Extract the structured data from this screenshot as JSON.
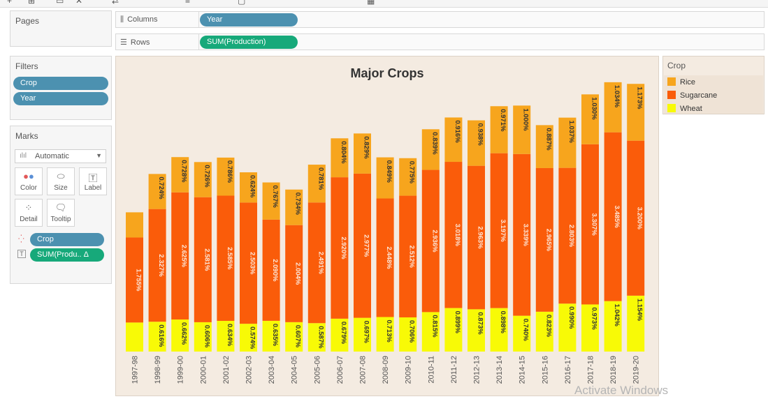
{
  "shelves": {
    "columns": {
      "label": "Columns",
      "pill": "Year"
    },
    "rows": {
      "label": "Rows",
      "pill": "SUM(Production)"
    }
  },
  "pages": {
    "title": "Pages"
  },
  "filters": {
    "title": "Filters",
    "pills": [
      "Crop",
      "Year"
    ]
  },
  "marks": {
    "title": "Marks",
    "type_select": "Automatic",
    "buttons": [
      "Color",
      "Size",
      "Label",
      "Detail",
      "Tooltip"
    ],
    "field_pills": [
      "Crop",
      "SUM(Produ.. Δ"
    ]
  },
  "legend": {
    "title": "Crop",
    "items": [
      {
        "name": "Rice",
        "color": "#f7a51d"
      },
      {
        "name": "Sugarcane",
        "color": "#fa5c0a"
      },
      {
        "name": "Wheat",
        "color": "#f8fa06"
      }
    ]
  },
  "watermark": "Activate Windows",
  "chart_data": {
    "type": "bar",
    "stacked": true,
    "title": "Major Crops",
    "categories": [
      "1997-98",
      "1998-99",
      "1999-00",
      "2000-01",
      "2001-02",
      "2002-03",
      "2003-04",
      "2004-05",
      "2005-06",
      "2006-07",
      "2007-08",
      "2008-09",
      "2009-10",
      "2010-11",
      "2011-12",
      "2012-13",
      "2013-14",
      "2014-15",
      "2015-16",
      "2016-17",
      "2017-18",
      "2018-19",
      "2019-20"
    ],
    "series": [
      {
        "name": "Wheat",
        "color": "#f8fa06",
        "values": [
          0.6,
          0.616,
          0.662,
          0.606,
          0.634,
          0.574,
          0.635,
          0.607,
          0.587,
          0.679,
          0.697,
          0.713,
          0.706,
          0.815,
          0.899,
          0.873,
          0.898,
          0.74,
          0.823,
          0.99,
          0.973,
          1.042,
          1.154
        ],
        "labels": [
          "",
          "0.616%",
          "0.662%",
          "0.606%",
          "0.634%",
          "0.574%",
          "0.635%",
          "0.607%",
          "0.587%",
          "0.679%",
          "0.697%",
          "0.713%",
          "0.706%",
          "0.815%",
          "0.899%",
          "0.873%",
          "0.898%",
          "0.740%",
          "0.823%",
          "0.990%",
          "0.973%",
          "1.042%",
          "1.154%"
        ]
      },
      {
        "name": "Sugarcane",
        "color": "#fa5c0a",
        "values": [
          1.755,
          2.327,
          2.625,
          2.581,
          2.585,
          2.503,
          2.09,
          2.004,
          2.491,
          2.92,
          2.977,
          2.448,
          2.512,
          2.936,
          3.018,
          2.963,
          3.197,
          3.339,
          2.965,
          2.803,
          3.307,
          3.485,
          3.2
        ],
        "labels": [
          "1.755%",
          "2.327%",
          "2.625%",
          "2.581%",
          "2.585%",
          "2.503%",
          "2.090%",
          "2.004%",
          "2.491%",
          "2.920%",
          "2.977%",
          "2.448%",
          "2.512%",
          "2.936%",
          "3.018%",
          "2.963%",
          "3.197%",
          "3.339%",
          "2.965%",
          "2.803%",
          "3.307%",
          "3.485%",
          "3.200%"
        ]
      },
      {
        "name": "Rice",
        "color": "#f7a51d",
        "values": [
          0.52,
          0.724,
          0.728,
          0.726,
          0.786,
          0.624,
          0.767,
          0.734,
          0.781,
          0.804,
          0.829,
          0.849,
          0.775,
          0.839,
          0.916,
          0.938,
          0.971,
          1.0,
          0.887,
          1.037,
          1.03,
          1.034,
          1.173
        ],
        "labels": [
          "",
          "0.724%",
          "0.728%",
          "0.726%",
          "0.786%",
          "0.624%",
          "0.767%",
          "0.734%",
          "0.781%",
          "0.804%",
          "0.829%",
          "0.849%",
          "0.775%",
          "0.839%",
          "0.916%",
          "0.938%",
          "0.971%",
          "1.000%",
          "0.887%",
          "1.037%",
          "1.030%",
          "1.034%",
          "1.173%"
        ]
      }
    ],
    "ylim": [
      0,
      5.8
    ],
    "grid": false,
    "legend_position": "right"
  }
}
